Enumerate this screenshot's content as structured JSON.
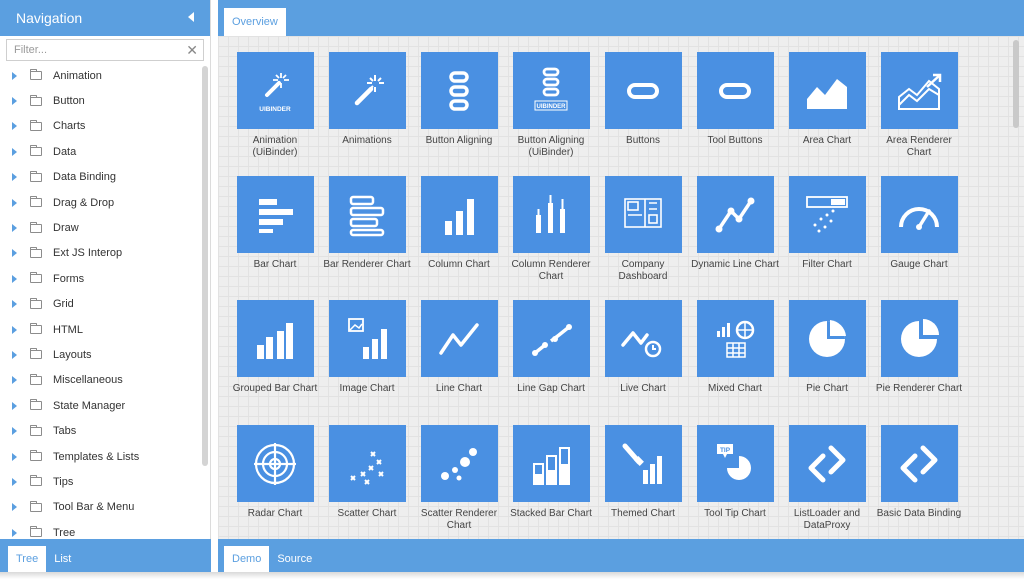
{
  "nav": {
    "title": "Navigation",
    "filter_placeholder": "Filter...",
    "items": [
      {
        "label": "Animation"
      },
      {
        "label": "Button"
      },
      {
        "label": "Charts"
      },
      {
        "label": "Data"
      },
      {
        "label": "Data Binding"
      },
      {
        "label": "Drag & Drop"
      },
      {
        "label": "Draw"
      },
      {
        "label": "Ext JS Interop"
      },
      {
        "label": "Forms"
      },
      {
        "label": "Grid"
      },
      {
        "label": "HTML"
      },
      {
        "label": "Layouts"
      },
      {
        "label": "Miscellaneous"
      },
      {
        "label": "State Manager"
      },
      {
        "label": "Tabs"
      },
      {
        "label": "Templates & Lists"
      },
      {
        "label": "Tips"
      },
      {
        "label": "Tool Bar & Menu"
      },
      {
        "label": "Tree"
      }
    ],
    "tabs": {
      "tree": "Tree",
      "list": "List"
    }
  },
  "main": {
    "tab": "Overview",
    "footer_tabs": {
      "demo": "Demo",
      "source": "Source"
    },
    "tiles": [
      {
        "label": "Animation (UiBinder)",
        "icon": "wand-uibinder-icon"
      },
      {
        "label": "Animations",
        "icon": "wand-icon"
      },
      {
        "label": "Button Aligning",
        "icon": "stacked-buttons-icon"
      },
      {
        "label": "Button Aligning (UiBinder)",
        "icon": "stacked-buttons-uibinder-icon"
      },
      {
        "label": "Buttons",
        "icon": "button-icon"
      },
      {
        "label": "Tool Buttons",
        "icon": "tool-button-icon"
      },
      {
        "label": "Area Chart",
        "icon": "area-chart-icon"
      },
      {
        "label": "Area Renderer Chart",
        "icon": "area-renderer-chart-icon"
      },
      {
        "label": "Bar Chart",
        "icon": "bar-chart-icon"
      },
      {
        "label": "Bar Renderer Chart",
        "icon": "bar-renderer-chart-icon"
      },
      {
        "label": "Column Chart",
        "icon": "column-chart-icon"
      },
      {
        "label": "Column Renderer Chart",
        "icon": "column-renderer-chart-icon"
      },
      {
        "label": "Company Dashboard",
        "icon": "dashboard-icon"
      },
      {
        "label": "Dynamic Line Chart",
        "icon": "dynamic-line-chart-icon"
      },
      {
        "label": "Filter Chart",
        "icon": "filter-chart-icon"
      },
      {
        "label": "Gauge Chart",
        "icon": "gauge-chart-icon"
      },
      {
        "label": "Grouped Bar Chart",
        "icon": "grouped-bar-chart-icon"
      },
      {
        "label": "Image Chart",
        "icon": "image-chart-icon"
      },
      {
        "label": "Line Chart",
        "icon": "line-chart-icon"
      },
      {
        "label": "Line Gap Chart",
        "icon": "line-gap-chart-icon"
      },
      {
        "label": "Live Chart",
        "icon": "live-chart-icon"
      },
      {
        "label": "Mixed Chart",
        "icon": "mixed-chart-icon"
      },
      {
        "label": "Pie Chart",
        "icon": "pie-chart-icon"
      },
      {
        "label": "Pie Renderer Chart",
        "icon": "pie-renderer-chart-icon"
      },
      {
        "label": "Radar Chart",
        "icon": "radar-chart-icon"
      },
      {
        "label": "Scatter Chart",
        "icon": "scatter-chart-icon"
      },
      {
        "label": "Scatter Renderer Chart",
        "icon": "scatter-renderer-chart-icon"
      },
      {
        "label": "Stacked Bar Chart",
        "icon": "stacked-bar-chart-icon"
      },
      {
        "label": "Themed Chart",
        "icon": "themed-chart-icon"
      },
      {
        "label": "Tool Tip Chart",
        "icon": "tooltip-chart-icon"
      },
      {
        "label": "ListLoader and DataProxy",
        "icon": "listloader-icon"
      },
      {
        "label": "Basic Data Binding",
        "icon": "data-binding-icon"
      }
    ],
    "icon_texts": {
      "uibinder": "UIBINDER",
      "tip": "TIP"
    }
  },
  "colors": {
    "accent": "#5b9fe0",
    "tile": "#4a90e2"
  }
}
